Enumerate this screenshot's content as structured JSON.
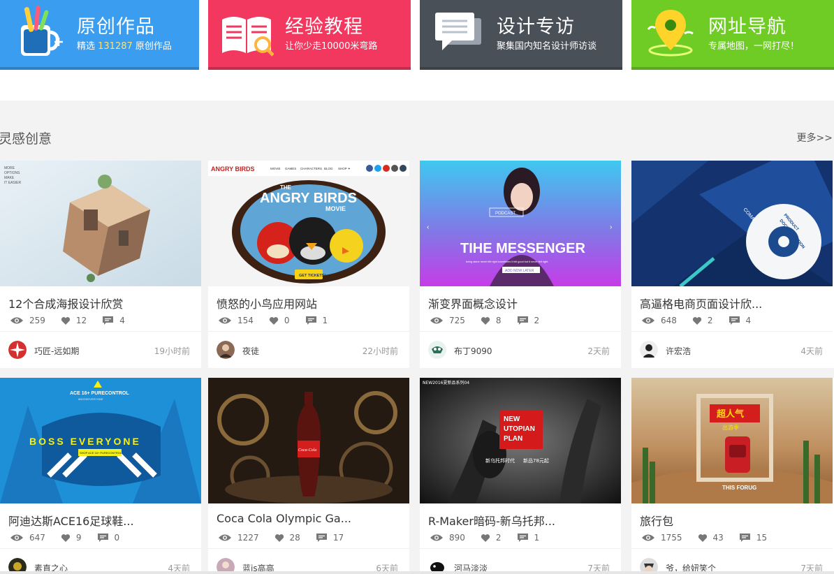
{
  "features": [
    {
      "title": "原创作品",
      "sub_pre": "精选 ",
      "sub_highlight": "131287",
      "sub_post": " 原创作品",
      "color": "#3a9df0",
      "icon": "paint-cup-icon"
    },
    {
      "title": "经验教程",
      "sub_pre": "让你少走10000米弯路",
      "sub_highlight": "",
      "sub_post": "",
      "color": "#f2385f",
      "icon": "book-magnifier-icon"
    },
    {
      "title": "设计专访",
      "sub_pre": "聚集国内知名设计师访谈",
      "sub_highlight": "",
      "sub_post": "",
      "color": "#4a5058",
      "icon": "chat-bubbles-icon"
    },
    {
      "title": "网址导航",
      "sub_pre": "专属地图，一网打尽！",
      "sub_highlight": "",
      "sub_post": "",
      "color": "#6fcc25",
      "icon": "map-pin-icon"
    }
  ],
  "section": {
    "title": "灵感创意",
    "more": "更多>>"
  },
  "cards": [
    {
      "title": "12个合成海报设计欣赏",
      "views": "259",
      "likes": "12",
      "comments": "4",
      "author": "巧匠-远如期",
      "time": "19小时前"
    },
    {
      "title": "愤怒的小鸟应用网站",
      "views": "154",
      "likes": "0",
      "comments": "1",
      "author": "夜徒",
      "time": "22小时前"
    },
    {
      "title": "渐变界面概念设计",
      "views": "725",
      "likes": "8",
      "comments": "2",
      "author": "布丁9090",
      "time": "2天前"
    },
    {
      "title": "高逼格电商页面设计欣...",
      "views": "648",
      "likes": "2",
      "comments": "4",
      "author": "许宏浩",
      "time": "4天前"
    },
    {
      "title": "阿迪达斯ACE16足球鞋...",
      "views": "647",
      "likes": "9",
      "comments": "0",
      "author": "素直之心",
      "time": "4天前"
    },
    {
      "title": "Coca Cola Olympic Ga...",
      "views": "1227",
      "likes": "28",
      "comments": "17",
      "author": "蓝is高高",
      "time": "6天前"
    },
    {
      "title": "R-Maker暗码-新乌托邦...",
      "views": "890",
      "likes": "2",
      "comments": "1",
      "author": "河马淡淡",
      "time": "7天前"
    },
    {
      "title": "旅行包",
      "views": "1755",
      "likes": "43",
      "comments": "15",
      "author": "爷，给妞笑个",
      "time": "7天前"
    }
  ],
  "thumbs": {
    "t1": {
      "tag1": "MORE",
      "tag2": "OPTIONS",
      "tag3": "MAKE",
      "tag4": "IT EASIER"
    },
    "t2": {
      "logo": "ANGRY BIRDS",
      "nav": [
        "MOVIE",
        "GAMES",
        "CHARACTERS",
        "BLOG",
        "SHOP ✦"
      ],
      "the": "THE",
      "big": "ANGRY BIRDS",
      "movie": "MOVIE",
      "cta": "GET TICKETS!"
    },
    "t3": {
      "tag": "PODCAST",
      "head": "TIHE  MESSENGER",
      "line": "being alone never felt right sometimes it felt good but it never felt right.",
      "btn": "ADD NOW LATER"
    },
    "t4": {
      "brand": "COMARCH",
      "disc1": "PRODUCT",
      "disc2": "DOCUMENTATION"
    },
    "t5": {
      "top": "ACE 16+ PURECONTROL",
      "sub": "#BOSSEVERYONE",
      "big": "BOSS EVERYONE",
      "btn": "SHOP ACE 16+ PURECONTROL"
    },
    "t6": {
      "brand": "Coca-Cola"
    },
    "t7": {
      "corner": "NEW2016夏新品系列04",
      "l1": "NEW",
      "l2": "UTOPIAN",
      "l3": "PLAN",
      "tag": "新乌托邦时代",
      "price": "新品78元起"
    },
    "t8": {
      "sign": "超人气",
      "sub": "出游季",
      "bottom": "THIS FORUG"
    }
  }
}
